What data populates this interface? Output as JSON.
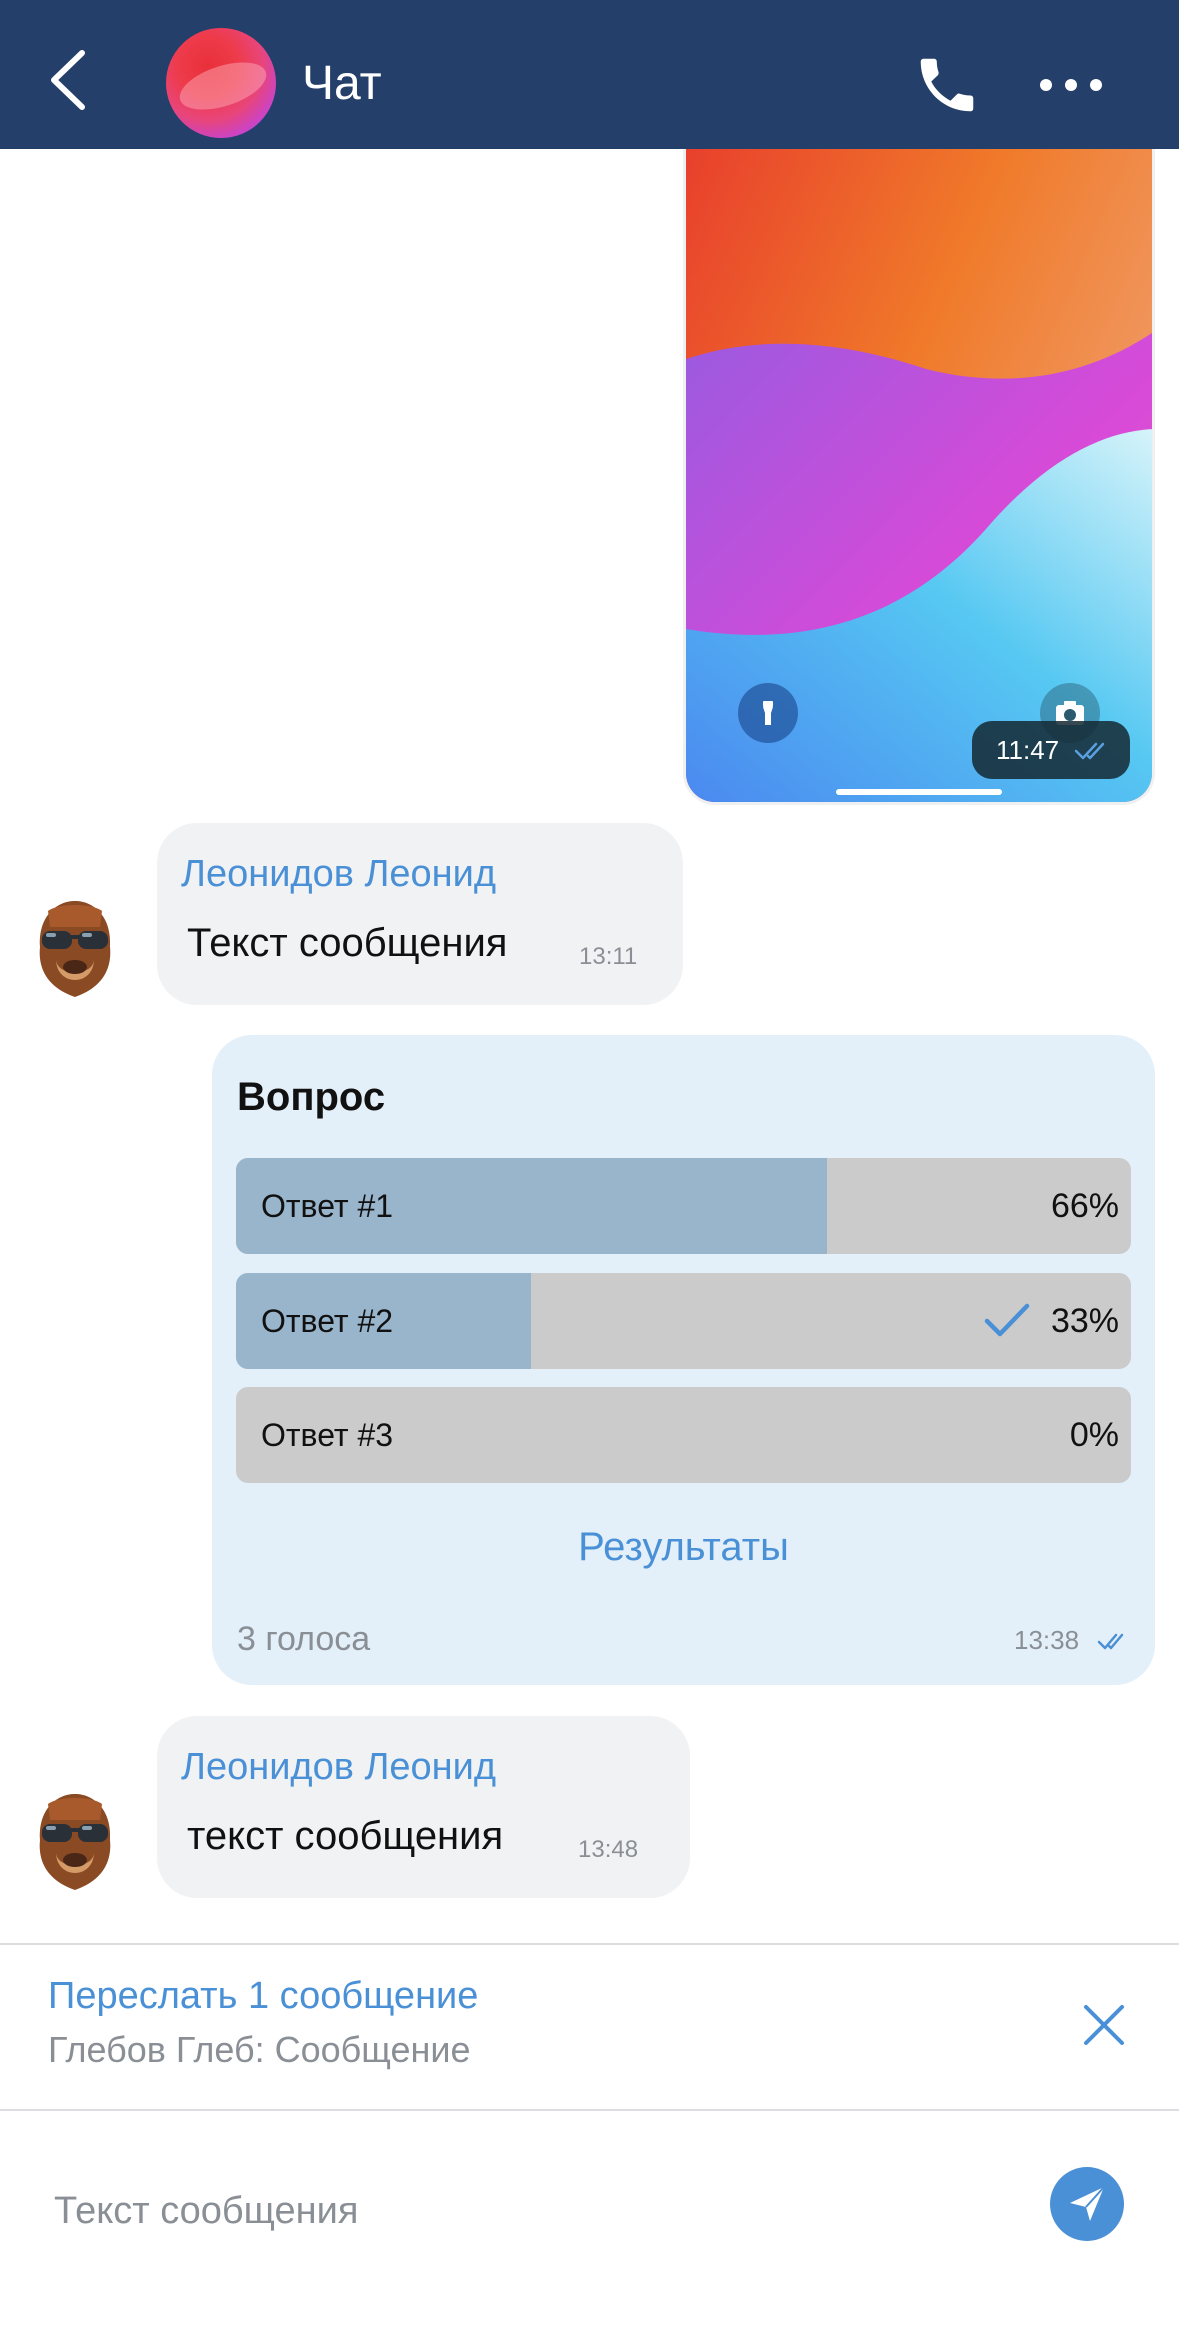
{
  "header": {
    "title": "Чат",
    "icons": {
      "back": "chevron-left-icon",
      "call": "phone-icon",
      "more": "more-horizontal-icon"
    },
    "background": "#243f69"
  },
  "image_message": {
    "time": "11:47",
    "status_icon": "double-check-icon",
    "overlay_icons": [
      "flashlight-icon",
      "camera-icon"
    ]
  },
  "messages": [
    {
      "sender": "Леонидов Леонид",
      "text": "Текст сообщения",
      "time": "13:11"
    },
    {
      "sender": "Леонидов Леонид",
      "text": "текст сообщения",
      "time": "13:48"
    }
  ],
  "poll": {
    "question": "Вопрос",
    "options": [
      {
        "label": "Ответ #1",
        "percent_text": "66%",
        "percent": 66,
        "selected": false
      },
      {
        "label": "Ответ #2",
        "percent_text": "33%",
        "percent": 33,
        "selected": true
      },
      {
        "label": "Ответ #3",
        "percent_text": "0%",
        "percent": 0,
        "selected": false
      }
    ],
    "results_label": "Результаты",
    "votes": "3 голоса",
    "time": "13:38"
  },
  "forward": {
    "title": "Переслать 1 сообщение",
    "subtitle": "Глебов Глеб: Сообщение"
  },
  "composer": {
    "placeholder": "Текст сообщения",
    "value": ""
  },
  "colors": {
    "accent": "#4a90d6",
    "incoming_bubble": "#f1f2f4",
    "outgoing_bubble": "#e4f0f9",
    "poll_fill": "#98b5cc",
    "poll_track": "#cbcbcb"
  }
}
